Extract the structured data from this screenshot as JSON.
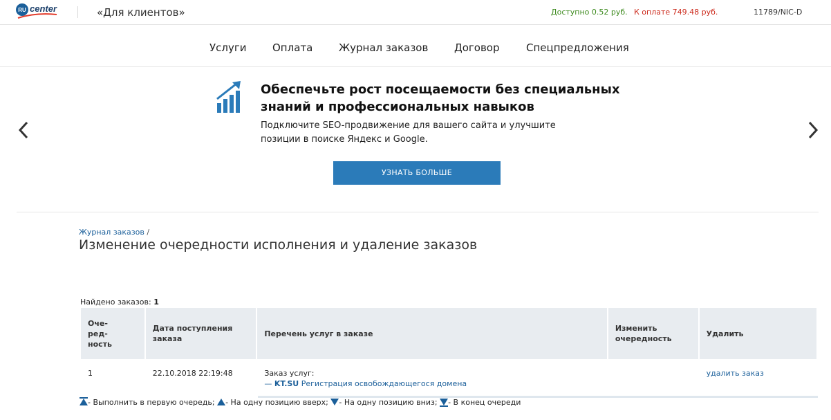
{
  "header": {
    "logo_text": "RU center",
    "client_title": "«Для клиентов»",
    "balance_available": "Доступно 0.52 руб.",
    "balance_due": "К оплате 749.48 руб.",
    "account_id": "11789/NIC-D"
  },
  "nav": {
    "items": [
      "Услуги",
      "Оплата",
      "Журнал заказов",
      "Договор",
      "Спецпредложения"
    ]
  },
  "banner": {
    "title": "Обеспечьте рост посещаемости без специальных знаний и профессиональных навыков",
    "text": "Подключите SEO-продвижение для вашего сайта и улучшите позиции в поиске Яндекс и Google.",
    "button_label": "УЗНАТЬ БОЛЬШЕ",
    "icon": "growth-chart-icon"
  },
  "breadcrumb": {
    "link": "Журнал заказов",
    "separator": "/"
  },
  "page_title": "Изменение очередности исполнения и удаление заказов",
  "found": {
    "label": "Найдено заказов:",
    "count": "1"
  },
  "table": {
    "headers": [
      "Оче-\nред-\nность",
      "Дата поступления заказа",
      "Перечень услуг в заказе",
      "Изменить очередность",
      "Удалить"
    ],
    "rows": [
      {
        "queue": "1",
        "date": "22.10.2018 22:19:48",
        "order_label": "Заказ услуг:",
        "domain_prefix": "—",
        "domain": "KT.SU",
        "service": "Регистрация освобождающегося домена",
        "delete_label": "удалить заказ"
      }
    ]
  },
  "legend": {
    "first": "- Выполнить в первую очередь;",
    "up": "- На одну позицию вверх;",
    "down": "- На одну позицию вниз;",
    "last": "- В конец очереди"
  },
  "colors": {
    "accent": "#2b7bb9",
    "link": "#1b5f9a",
    "available": "#3d8a1e",
    "due": "#cc2a1c",
    "table_header": "#e8ecf0"
  }
}
